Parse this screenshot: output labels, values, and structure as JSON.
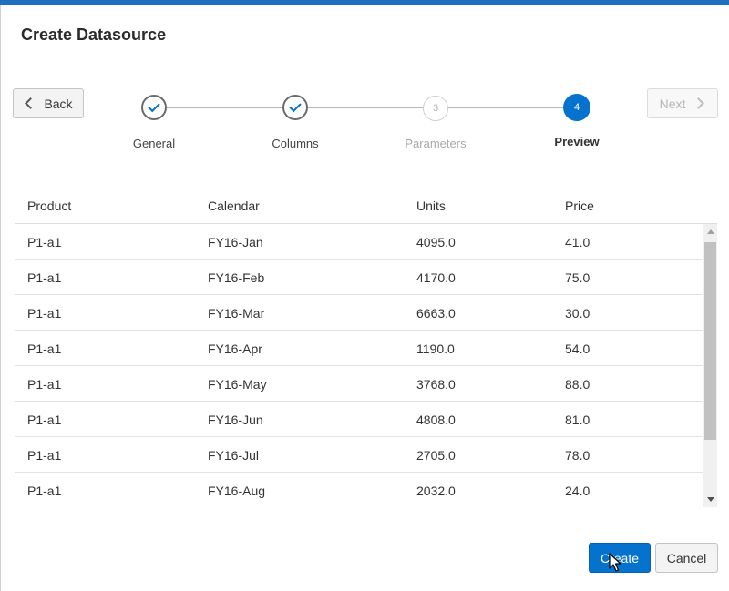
{
  "dialog": {
    "title": "Create Datasource"
  },
  "nav": {
    "back_label": "Back",
    "next_label": "Next"
  },
  "steps": [
    {
      "number": "1",
      "label": "General",
      "state": "done"
    },
    {
      "number": "2",
      "label": "Columns",
      "state": "done"
    },
    {
      "number": "3",
      "label": "Parameters",
      "state": "pending"
    },
    {
      "number": "4",
      "label": "Preview",
      "state": "current"
    }
  ],
  "table": {
    "headers": [
      "Product",
      "Calendar",
      "Units",
      "Price"
    ],
    "rows": [
      [
        "P1-a1",
        "FY16-Jan",
        "4095.0",
        "41.0"
      ],
      [
        "P1-a1",
        "FY16-Feb",
        "4170.0",
        "75.0"
      ],
      [
        "P1-a1",
        "FY16-Mar",
        "6663.0",
        "30.0"
      ],
      [
        "P1-a1",
        "FY16-Apr",
        "1190.0",
        "54.0"
      ],
      [
        "P1-a1",
        "FY16-May",
        "3768.0",
        "88.0"
      ],
      [
        "P1-a1",
        "FY16-Jun",
        "4808.0",
        "81.0"
      ],
      [
        "P1-a1",
        "FY16-Jul",
        "2705.0",
        "78.0"
      ],
      [
        "P1-a1",
        "FY16-Aug",
        "2032.0",
        "24.0"
      ]
    ]
  },
  "footer": {
    "create_label": "Create",
    "cancel_label": "Cancel"
  },
  "colors": {
    "accent": "#0572ce",
    "top_bar": "#1f6fbf"
  }
}
